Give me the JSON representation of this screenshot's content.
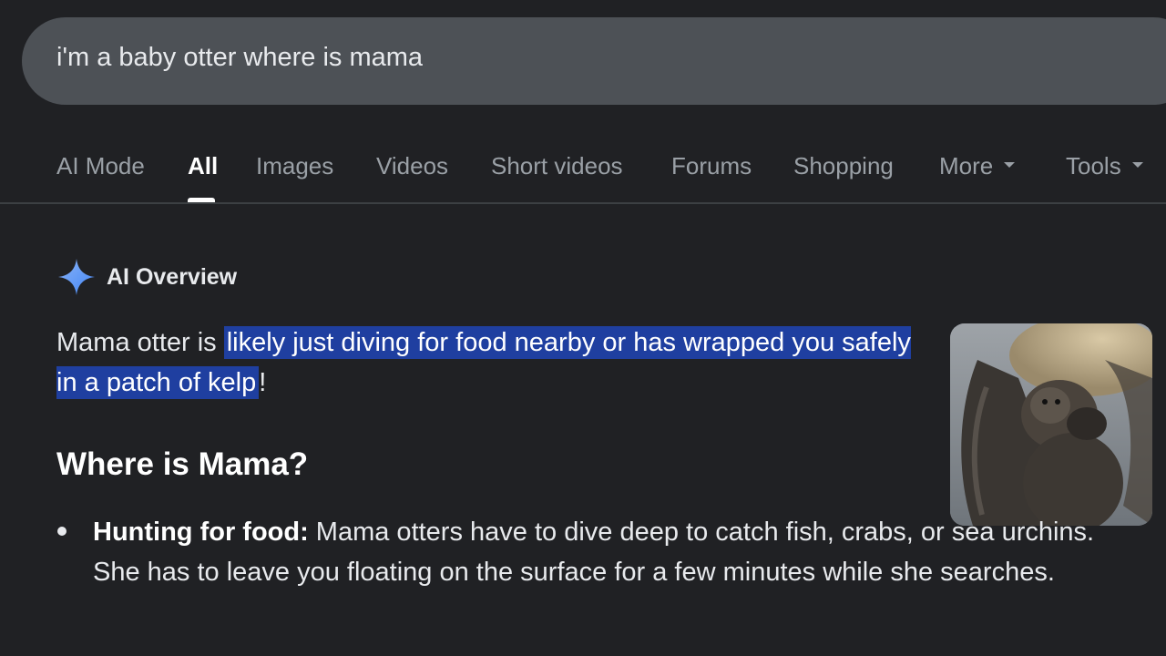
{
  "search": {
    "query": "i'm a baby otter where is mama"
  },
  "tabs": [
    {
      "label": "AI Mode",
      "active": false
    },
    {
      "label": "All",
      "active": true
    },
    {
      "label": "Images",
      "active": false
    },
    {
      "label": "Videos",
      "active": false
    },
    {
      "label": "Short videos",
      "active": false
    },
    {
      "label": "Forums",
      "active": false
    },
    {
      "label": "Shopping",
      "active": false
    },
    {
      "label": "More",
      "active": false,
      "dropdown": true
    },
    {
      "label": "Tools",
      "active": false,
      "dropdown": true
    }
  ],
  "overview": {
    "icon": "sparkle-icon",
    "title": "AI Overview",
    "answer_prefix": "Mama otter is ",
    "answer_highlight": "likely just diving for food nearby or has wrapped you safely in a patch of kelp",
    "answer_suffix": "!",
    "image_alt": "Mother otter holding baby otter",
    "section_heading": "Where is Mama?",
    "bullets": [
      {
        "title": "Hunting for food:",
        "text": " Mama otters have to dive deep to catch fish, crabs, or sea urchins. She has to leave you floating on the surface for a few minutes while she searches."
      }
    ]
  },
  "colors": {
    "background": "#202124",
    "search_bar": "#4d5156",
    "highlight": "#1f3fa0",
    "sparkle": "#4285f4"
  }
}
